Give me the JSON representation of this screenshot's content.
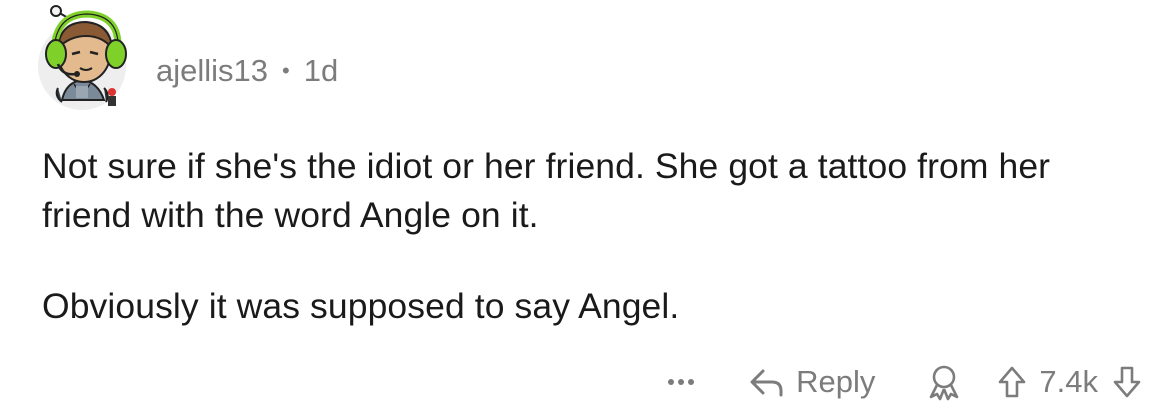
{
  "comment": {
    "author": "ajellis13",
    "separator": "•",
    "age": "1d",
    "paragraphs": [
      "Not sure if she's the idiot or her friend.  She got a tattoo from her friend with the word Angle on it.",
      "Obviously it was supposed to say Angel."
    ],
    "actions": {
      "more_icon": "more-icon",
      "reply_icon": "reply-arrow-icon",
      "reply_label": "Reply",
      "award_icon": "award-icon",
      "upvote_icon": "upvote-arrow-icon",
      "score": "7.4k",
      "downvote_icon": "downvote-arrow-icon"
    }
  },
  "colors": {
    "text": "#1a1a1b",
    "meta": "#7c7c7c",
    "headset_green": "#7fd12a"
  }
}
